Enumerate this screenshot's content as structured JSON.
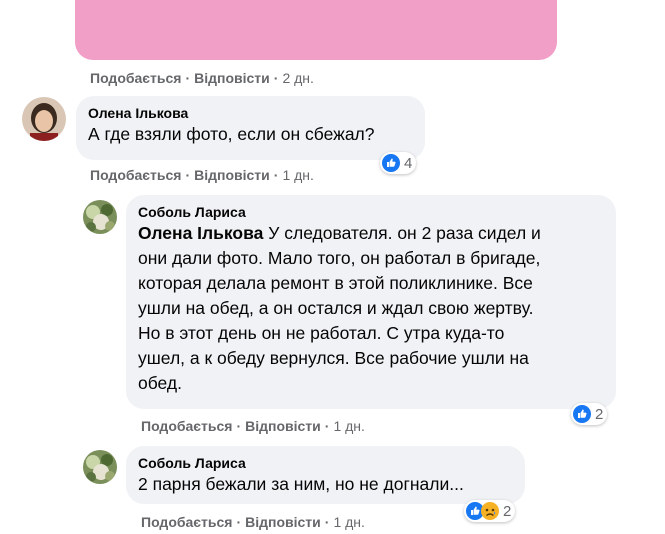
{
  "actions": {
    "like": "Подобається",
    "reply": "Відповісти",
    "sep": "·"
  },
  "comments": [
    {
      "time": "2 дн."
    },
    {
      "author": "Олена Ількова",
      "text": "А где взяли фото, если он сбежал?",
      "reaction_count": "4",
      "time": "1 дн."
    },
    {
      "author": "Соболь Лариса",
      "mention": "Олена Ількова",
      "lines": [
        " У следователя. он 2 раза сидел и",
        "они дали фото. Мало того, он работал в бригаде,",
        "которая делала ремонт в этой поликлинике. Все",
        "ушли на обед, а он остался и ждал свою жертву.",
        "Но в этот день он не работал. С утра куда-то",
        "ушел, а к обеду вернулся. Все рабочие ушли на",
        "обед."
      ],
      "reaction_count": "2",
      "time": "1 дн."
    },
    {
      "author": "Соболь Лариса",
      "text": "2 парня бежали за ним, но не догнали...",
      "reaction_count": "2",
      "time": "1 дн."
    }
  ],
  "colors": {
    "like_blue": "#1877f2",
    "pink_card": "#f19fc6",
    "bubble": "#f0f2f5",
    "meta_gray": "#65676b"
  }
}
